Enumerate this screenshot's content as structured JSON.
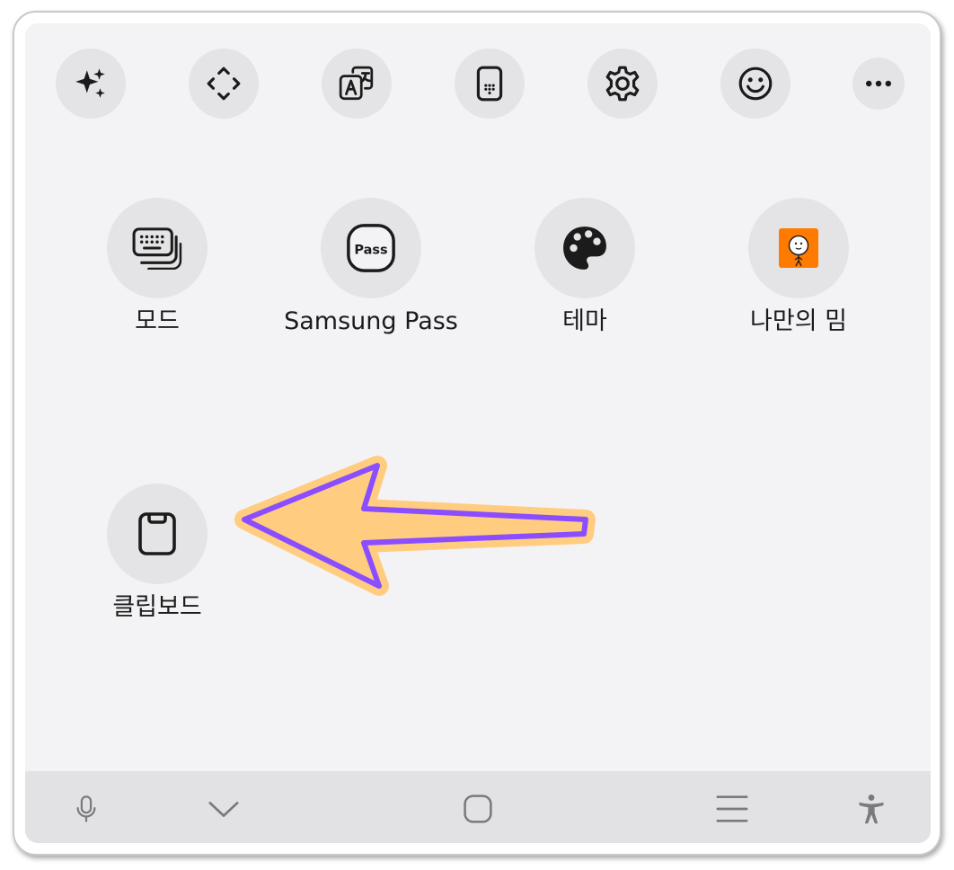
{
  "toolbar": {
    "items": [
      {
        "icon": "ai-sparkle-icon"
      },
      {
        "icon": "move-cursor-icon"
      },
      {
        "icon": "translate-icon"
      },
      {
        "icon": "numeric-keypad-icon"
      },
      {
        "icon": "settings-gear-icon"
      },
      {
        "icon": "emoji-smile-icon"
      },
      {
        "icon": "more-options-icon"
      }
    ]
  },
  "grid": {
    "items": [
      {
        "label": "모드",
        "icon": "keyboard-modes-icon"
      },
      {
        "label": "Samsung Pass",
        "icon": "samsung-pass-icon",
        "icon_text": "Pass"
      },
      {
        "label": "테마",
        "icon": "palette-icon"
      },
      {
        "label": "나만의 밈",
        "icon": "my-meme-icon"
      },
      {
        "label": "클립보드",
        "icon": "clipboard-icon"
      }
    ]
  },
  "navbar": {
    "items": [
      {
        "icon": "microphone-icon"
      },
      {
        "icon": "chevron-down-icon"
      },
      {
        "icon": "home-square-icon"
      },
      {
        "icon": "recent-apps-icon"
      },
      {
        "icon": "accessibility-icon"
      }
    ]
  },
  "annotation": {
    "icon": "pointer-arrow-icon",
    "fill": "#ffcc80",
    "stroke": "#8a4dff"
  },
  "colors": {
    "panel_bg": "#f3f3f5",
    "button_bg": "#e4e4e6",
    "navbar_bg": "#e2e2e4",
    "meme_bg": "#ff7a00"
  }
}
